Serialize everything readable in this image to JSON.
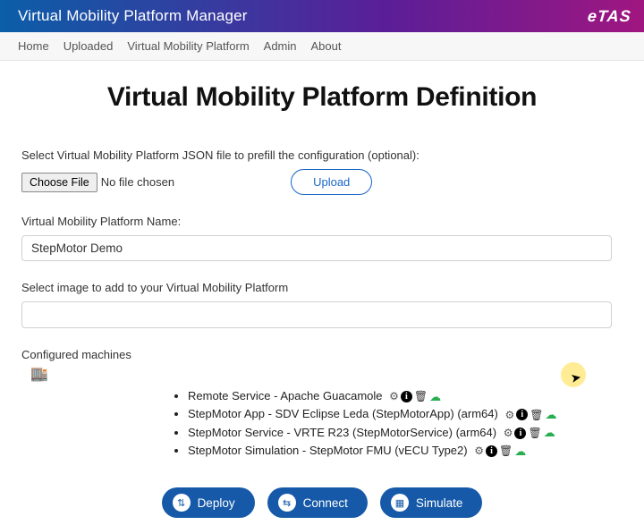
{
  "header": {
    "title": "Virtual Mobility Platform Manager",
    "brand": "eTAS"
  },
  "nav": {
    "items": [
      "Home",
      "Uploaded",
      "Virtual Mobility Platform",
      "Admin",
      "About"
    ]
  },
  "page": {
    "title": "Virtual Mobility Platform Definition"
  },
  "file_select": {
    "label": "Select Virtual Mobility Platform JSON file to prefill the configuration (optional):",
    "choose_btn": "Choose File",
    "no_file": "No file chosen",
    "upload_btn": "Upload"
  },
  "vmp_name": {
    "label": "Virtual Mobility Platform Name:",
    "value": "StepMotor Demo"
  },
  "image_select": {
    "label": "Select image to add to your Virtual Mobility Platform",
    "value": ""
  },
  "machines": {
    "label": "Configured machines",
    "items": [
      {
        "text": "Remote Service - Apache Guacamole"
      },
      {
        "text": "StepMotor App - SDV Eclipse Leda (StepMotorApp) (arm64)"
      },
      {
        "text": "StepMotor Service - VRTE R23 (StepMotorService) (arm64)"
      },
      {
        "text": "StepMotor Simulation - StepMotor FMU (vECU Type2)"
      }
    ]
  },
  "actions": {
    "deploy": "Deploy",
    "connect": "Connect",
    "simulate": "Simulate"
  },
  "icons": {
    "gear": "⚙",
    "info": "i",
    "trash": "🗑",
    "cloud": "☁",
    "store": "🏬",
    "deploy_glyph": "⇅",
    "connect_glyph": "⇆",
    "simulate_glyph": "▦",
    "cursor": "➤"
  }
}
